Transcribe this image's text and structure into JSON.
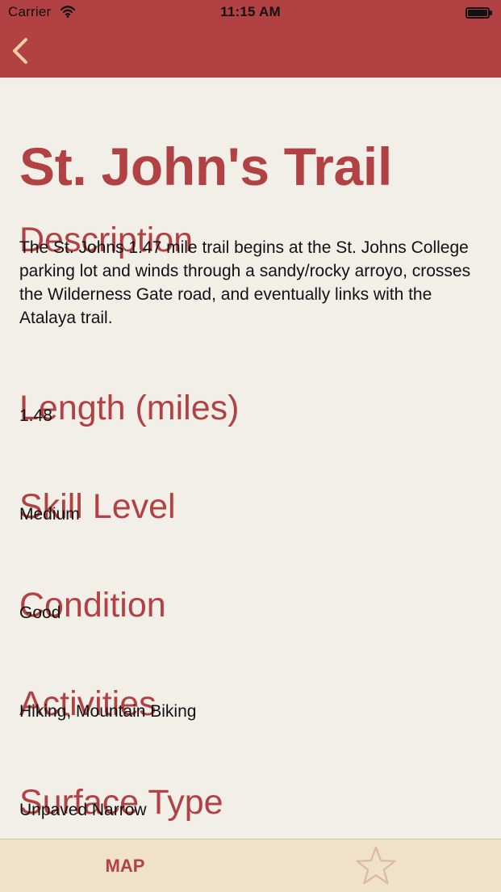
{
  "status_bar": {
    "carrier": "Carrier",
    "time": "11:15 AM",
    "wifi_icon": "wifi-icon",
    "battery_icon": "battery-icon"
  },
  "nav_bar": {
    "back_icon": "chevron-left-icon",
    "background_color": "#b14143",
    "accent_color": "#f2cfa3"
  },
  "trail": {
    "title": "St. John's Trail",
    "sections": [
      {
        "heading": "Description",
        "value": "The St. Johns 1.47 mile trail begins at the St. Johns College parking lot and winds through a sandy/rocky arroyo, crosses the Wilderness Gate road, and eventually links with the Atalaya trail."
      },
      {
        "heading": "Length (miles)",
        "value": "1.48"
      },
      {
        "heading": "Skill Level",
        "value": "Medium"
      },
      {
        "heading": "Condition",
        "value": "Good"
      },
      {
        "heading": "Activities",
        "value": "Hiking, Mountain Biking"
      },
      {
        "heading": "Surface Type",
        "value": "Unpaved Narrow"
      }
    ]
  },
  "tab_bar": {
    "map_label": "MAP",
    "favorite_icon": "star-outline-icon"
  },
  "colors": {
    "page_background": "#f2efe8",
    "heading_text": "#b14143",
    "tab_bar_background": "#f0e1c9"
  }
}
